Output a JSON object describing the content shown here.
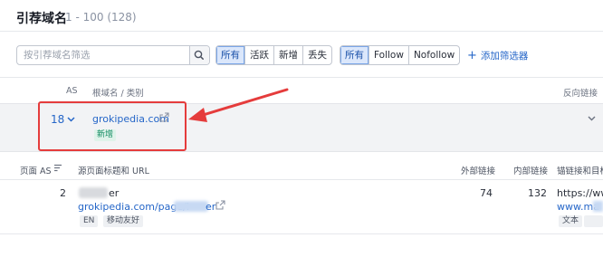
{
  "header": {
    "title": "引荐域名",
    "range": "1 - 100 (128)"
  },
  "search": {
    "placeholder": "按引荐域名筛选",
    "icon": "search-icon"
  },
  "status_filters": [
    {
      "label": "所有",
      "active": true
    },
    {
      "label": "活跃",
      "active": false
    },
    {
      "label": "新增",
      "active": false
    },
    {
      "label": "丢失",
      "active": false
    }
  ],
  "link_filters": [
    {
      "label": "所有",
      "active": true
    },
    {
      "label": "Follow",
      "active": false
    },
    {
      "label": "Nofollow",
      "active": false
    }
  ],
  "add_filter": {
    "label": "添加筛选器"
  },
  "columns": {
    "as": "AS",
    "root_domain": "根域名 / 类别",
    "backlinks": "反向链接"
  },
  "domain_row": {
    "as": "18",
    "domain": "grokipedia.com",
    "badge": "新增"
  },
  "subtable": {
    "headers": {
      "page_as": "页面 AS",
      "source": "源页面标题和 URL",
      "external": "外部链接",
      "internal": "内部链接",
      "anchor": "锚链接和目标"
    },
    "row": {
      "page_as": "2",
      "title_tail": "er",
      "url_prefix": "grokipedia.com/page/l",
      "url_tail": "er",
      "tags": [
        "EN",
        "移动友好"
      ],
      "external": "74",
      "internal": "132",
      "anchor_text": "https://ww",
      "anchor_link": "www.ma",
      "anchor_tag": "文本"
    }
  },
  "colors": {
    "accent": "#2566c8",
    "highlight": "#e53c3c",
    "active_bg": "#dbe7fb",
    "badge_green": "#0e8a5f"
  }
}
